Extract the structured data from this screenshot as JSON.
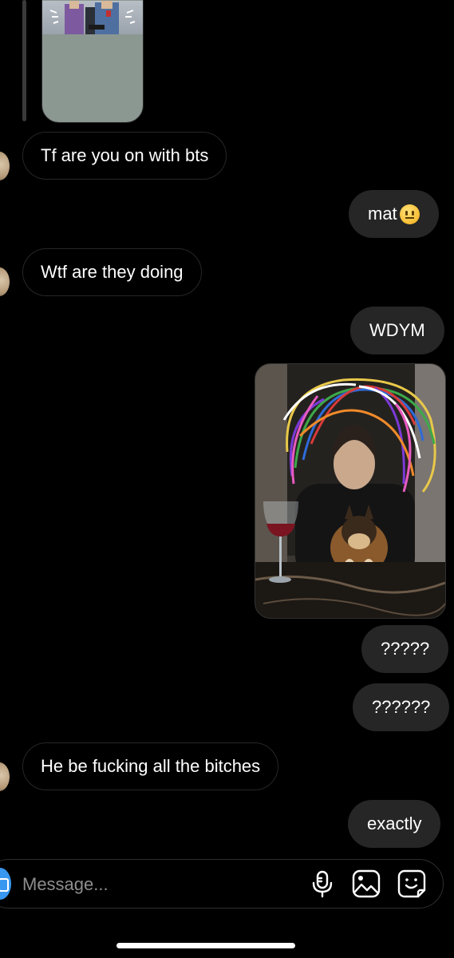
{
  "thread": {
    "messages": [
      {
        "id": "m1",
        "from": "them",
        "text": "Tf are you on with bts"
      },
      {
        "id": "m2",
        "from": "me",
        "text": "mat",
        "emoji": "neutral-face"
      },
      {
        "id": "m3",
        "from": "them",
        "text": "Wtf are they doing"
      },
      {
        "id": "m4",
        "from": "me",
        "text": "WDYM"
      },
      {
        "id": "m5",
        "from": "me",
        "type": "image",
        "image": "photo of a person with a dog, colorful scribbles drawn over"
      },
      {
        "id": "m6",
        "from": "me",
        "text": "?????"
      },
      {
        "id": "m7",
        "from": "me",
        "text": "??????"
      },
      {
        "id": "m8",
        "from": "them",
        "text": "He be fucking all the bitches"
      },
      {
        "id": "m9",
        "from": "me",
        "text": "exactly"
      }
    ]
  },
  "composer": {
    "placeholder": "Message...",
    "icons": [
      "camera-icon",
      "microphone-icon",
      "gallery-icon",
      "sticker-icon"
    ]
  },
  "colors": {
    "background": "#000000",
    "outgoing_bubble": "#262626",
    "incoming_border": "#262626",
    "accent": "#3897f0"
  }
}
